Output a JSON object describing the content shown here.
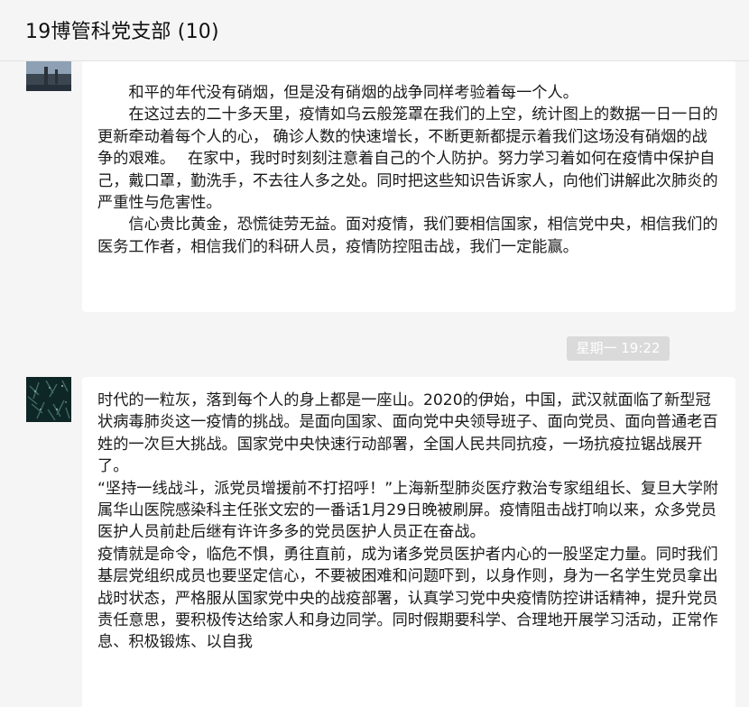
{
  "header": {
    "title": "19博管科党支部 (10)"
  },
  "messages": [
    {
      "paragraphs": [
        "和平的年代没有硝烟，但是没有硝烟的战争同样考验着每一个人。",
        "在这过去的二十多天里，疫情如乌云般笼罩在我们的上空，统计图上的数据一日一日的更新牵动着每个人的心， 确诊人数的快速增长，不断更新都提示着我们这场没有硝烟的战争的艰难。　 在家中，我时时刻刻注意着自己的个人防护。努力学习着如何在疫情中保护自己，戴口罩，勤洗手，不去往人多之处。同时把这些知识告诉家人，向他们讲解此次肺炎的严重性与危害性。",
        "信心贵比黄金，恐慌徒劳无益。面对疫情，我们要相信国家，相信党中央，相信我们的医务工作者，相信我们的科研人员，疫情防控阻击战，我们一定能赢。"
      ]
    },
    {
      "timestamp": "星期一 19:22",
      "paragraphs": [
        "时代的一粒灰，落到每个人的身上都是一座山。2020的伊始，中国，武汉就面临了新型冠状病毒肺炎这一疫情的挑战。是面向国家、面向党中央领导班子、面向党员、面向普通老百姓的一次巨大挑战。国家党中央快速行动部署，全国人民共同抗疫，一场抗疫拉锯战展开了。",
        "“坚持一线战斗，派党员增援前不打招呼！”上海新型肺炎医疗救治专家组组长、复旦大学附属华山医院感染科主任张文宏的一番话1月29日晚被刷屏。疫情阻击战打响以来，众多党员医护人员前赴后继有许许多多的党员医护人员正在奋战。",
        "疫情就是命令，临危不惧，勇往直前，成为诸多党员医护者内心的一股坚定力量。同时我们基层党组织成员也要坚定信心，不要被困难和问题吓到，以身作则，身为一名学生党员拿出战时状态，严格服从国家党中央的战疫部署，认真学习党中央疫情防控讲话精神，提升党员责任意思，要积极传达给家人和身边同学。同时假期要科学、合理地开展学习活动，正常作息、积极锻炼、以自我"
      ]
    }
  ]
}
